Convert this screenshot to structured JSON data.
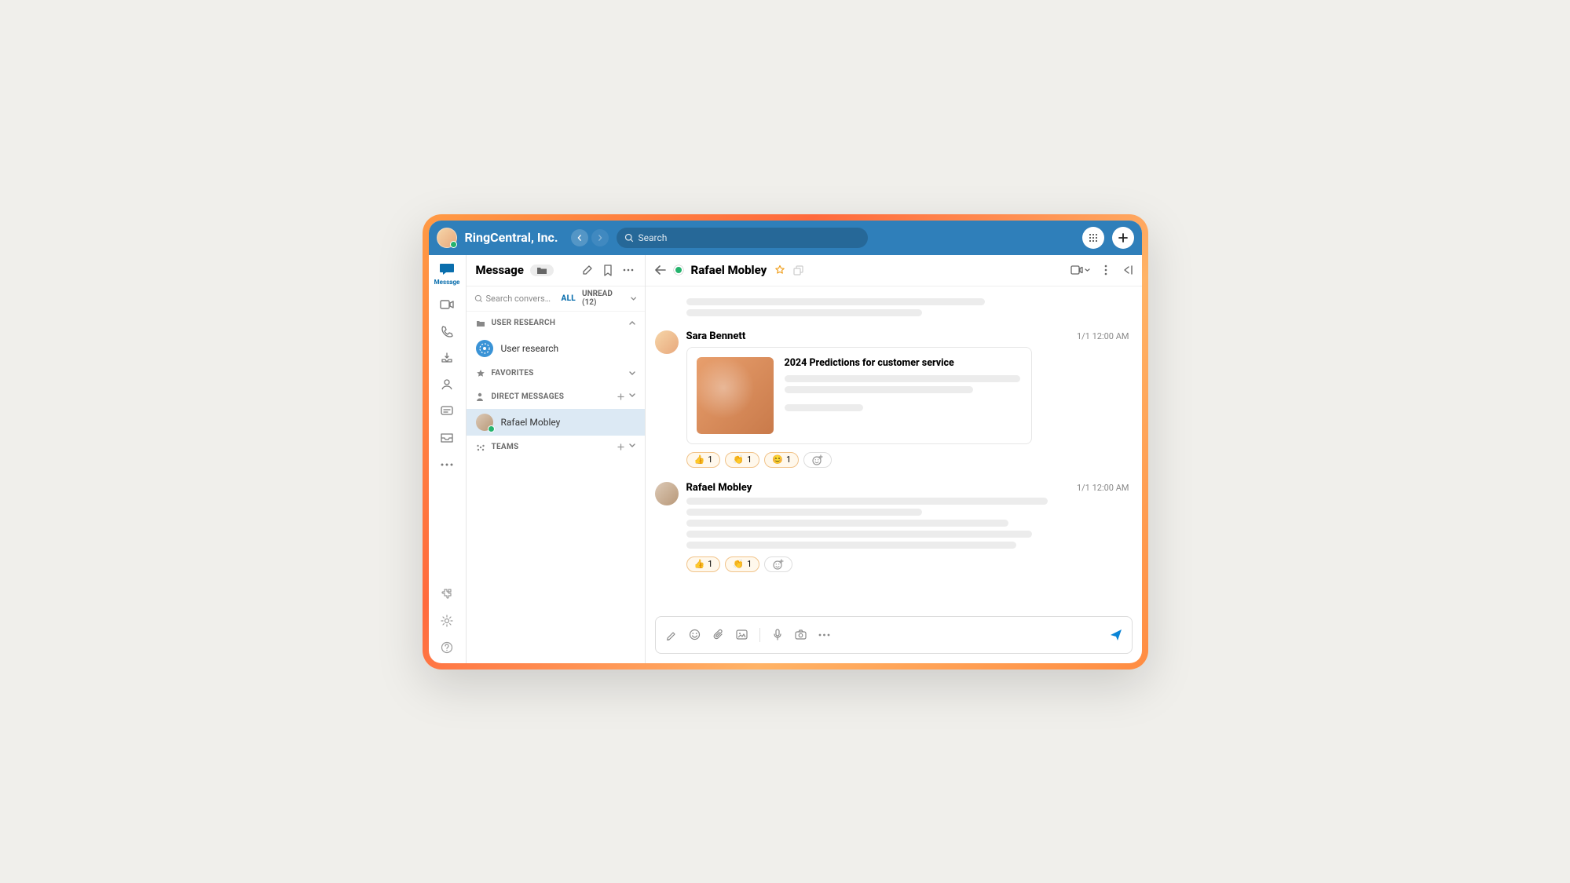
{
  "titlebar": {
    "org_name": "RingCentral, Inc.",
    "search_placeholder": "Search"
  },
  "rail": {
    "active_label": "Message"
  },
  "convlist": {
    "title": "Message",
    "search_placeholder": "Search conversation...",
    "tab_all": "ALL",
    "tab_unread": "UNREAD (12)",
    "groups": {
      "user_research": {
        "label": "USER RESEARCH"
      },
      "favorites": {
        "label": "FAVORITES"
      },
      "direct_messages": {
        "label": "DIRECT MESSAGES"
      },
      "teams": {
        "label": "TEAMS"
      }
    },
    "items": {
      "user_research_team": "User research",
      "rafael": "Rafael Mobley"
    }
  },
  "chat": {
    "title": "Rafael Mobley",
    "messages": [
      {
        "author": "Sara Bennett",
        "time": "1/1 12:00 AM",
        "card_title": "2024 Predictions for customer service",
        "reactions": [
          {
            "emoji": "👍",
            "count": "1"
          },
          {
            "emoji": "👏",
            "count": "1"
          },
          {
            "emoji": "😊",
            "count": "1"
          }
        ]
      },
      {
        "author": "Rafael Mobley",
        "time": "1/1 12:00 AM",
        "reactions": [
          {
            "emoji": "👍",
            "count": "1"
          },
          {
            "emoji": "👏",
            "count": "1"
          }
        ]
      }
    ]
  }
}
